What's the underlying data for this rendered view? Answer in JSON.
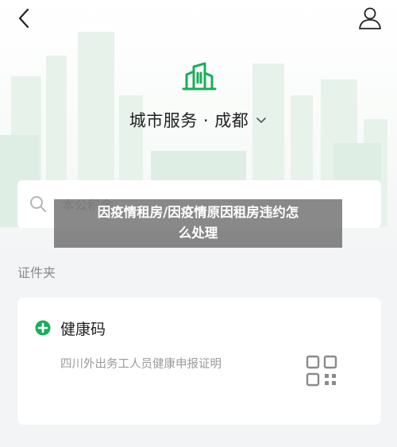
{
  "header": {
    "back_icon": "chevron-left-icon",
    "user_icon": "user-icon"
  },
  "service": {
    "title": "城市服务 · 成都",
    "logo_icon": "city-building-icon"
  },
  "search": {
    "placeholder": "本公积金"
  },
  "banner": {
    "line1": "因疫情租房/因疫情原因租房违约怎",
    "line2": "么处理"
  },
  "section": {
    "title": "证件夹"
  },
  "card": {
    "title": "健康码",
    "subtitle": "四川外出务工人员健康申报证明",
    "plus_icon": "plus-circle-icon",
    "qr_icon": "qr-code-icon"
  },
  "colors": {
    "accent": "#1aad5a",
    "banner_bg": "#5c5c5c"
  }
}
